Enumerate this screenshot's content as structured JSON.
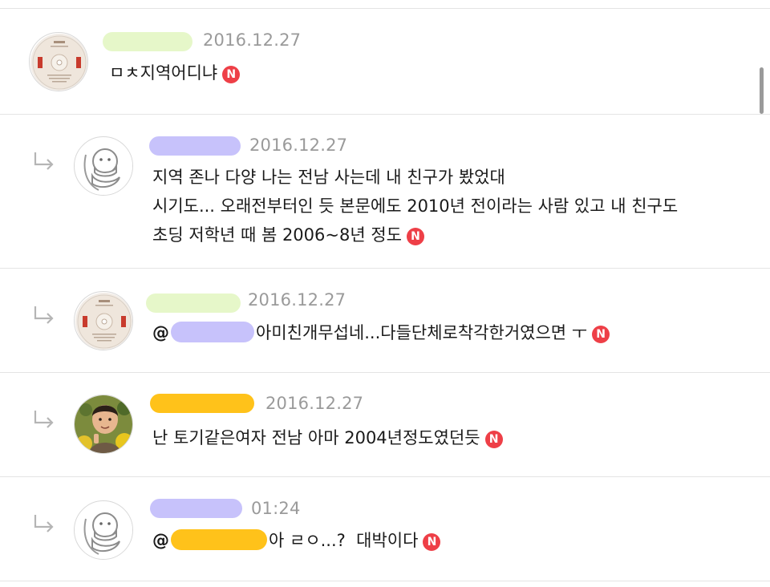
{
  "colors": {
    "mask_green": "#e6f7c9",
    "mask_purple": "#c7c2fb",
    "mask_orange": "#ffc21a",
    "badge_red": "#ee3f47",
    "date_gray": "#9a9a9a"
  },
  "new_badge_label": "N",
  "comments": [
    {
      "date": "2016.12.27",
      "lines": [
        "ㅁㅊ지역어디냐"
      ],
      "avatar": "cd-disc-icon",
      "is_reply": false
    },
    {
      "date": "2016.12.27",
      "lines": [
        "지역 존나 다양 나는 전남 사는데 내 친구가 봤었대",
        "시기도... 오래전부터인 듯 본문에도 2010년 전이라는 사람 있고 내 친구도",
        "초딩 저학년 때 봄 2006~8년 정도"
      ],
      "avatar": "default-bird-avatar-icon",
      "is_reply": true
    },
    {
      "date": "2016.12.27",
      "mention_at": "@",
      "lines": [
        "아미친개무섭네...다들단체로착각한거였으면 ㅜ"
      ],
      "avatar": "cd-disc-icon",
      "is_reply": true
    },
    {
      "date": "2016.12.27",
      "lines": [
        "난 토기같은여자 전남 아마 2004년정도였던듯"
      ],
      "avatar": "child-photo-avatar",
      "is_reply": true
    },
    {
      "date": "01:24",
      "mention_at": "@",
      "lines": [
        "아 ㄹㅇ...?  대박이다"
      ],
      "avatar": "default-bird-avatar-icon",
      "is_reply": true
    }
  ]
}
